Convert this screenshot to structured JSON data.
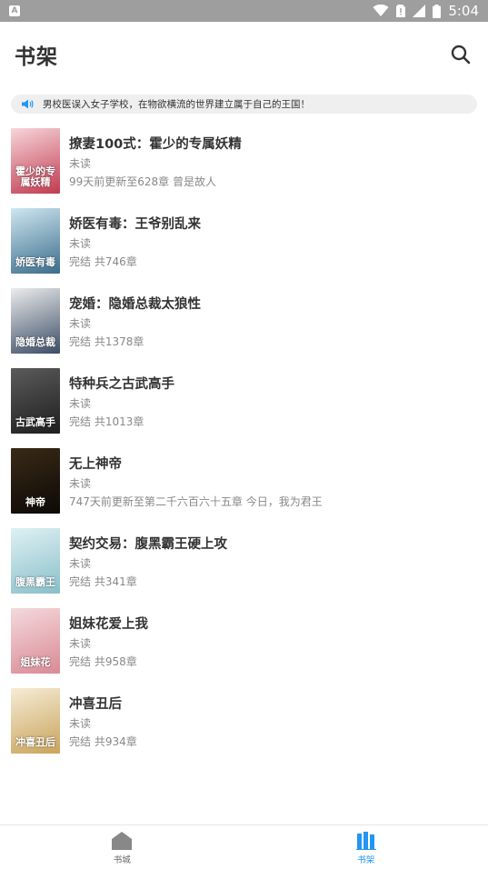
{
  "status_bar": {
    "time": "5:04"
  },
  "header": {
    "title": "书架"
  },
  "notice": {
    "text": "男校医误入女子学校，在物欲横流的世界建立属于自己的王国！"
  },
  "books": [
    {
      "title": "撩妻100式：霍少的专属妖精",
      "status": "未读",
      "update": "99天前更新至628章 曾是故人",
      "cover_text": "霍少的专属妖精",
      "cover_colors": [
        "#f6d6da",
        "#c23a4f"
      ]
    },
    {
      "title": "娇医有毒：王爷别乱来",
      "status": "未读",
      "update": "完结 共746章",
      "cover_text": "娇医有毒",
      "cover_colors": [
        "#cfe6f0",
        "#3a6d8c"
      ]
    },
    {
      "title": "宠婚：隐婚总裁太狼性",
      "status": "未读",
      "update": "完结 共1378章",
      "cover_text": "隐婚总裁",
      "cover_colors": [
        "#ececec",
        "#3b4d66"
      ]
    },
    {
      "title": "特种兵之古武高手",
      "status": "未读",
      "update": "完结 共1013章",
      "cover_text": "古武高手",
      "cover_colors": [
        "#5b5b5b",
        "#1e1e1e"
      ]
    },
    {
      "title": "无上神帝",
      "status": "未读",
      "update": "747天前更新至第二千六百六十五章 今日，我为君王",
      "cover_text": "神帝",
      "cover_colors": [
        "#3a2a16",
        "#0c0907"
      ]
    },
    {
      "title": "契约交易：腹黑霸王硬上攻",
      "status": "未读",
      "update": "完结 共341章",
      "cover_text": "腹黑霸王",
      "cover_colors": [
        "#dff1f4",
        "#88bfc8"
      ]
    },
    {
      "title": "姐妹花爱上我",
      "status": "未读",
      "update": "完结 共958章",
      "cover_text": "姐妹花",
      "cover_colors": [
        "#f4d9dc",
        "#d98a95"
      ]
    },
    {
      "title": "冲喜丑后",
      "status": "未读",
      "update": "完结 共934章",
      "cover_text": "冲喜丑后",
      "cover_colors": [
        "#f6ecd6",
        "#c9a35a"
      ]
    }
  ],
  "bottom_nav": [
    {
      "label": "书城",
      "active": false
    },
    {
      "label": "书架",
      "active": true
    }
  ],
  "colors": {
    "accent": "#2196f3",
    "status_bar": "#9e9e9e"
  }
}
